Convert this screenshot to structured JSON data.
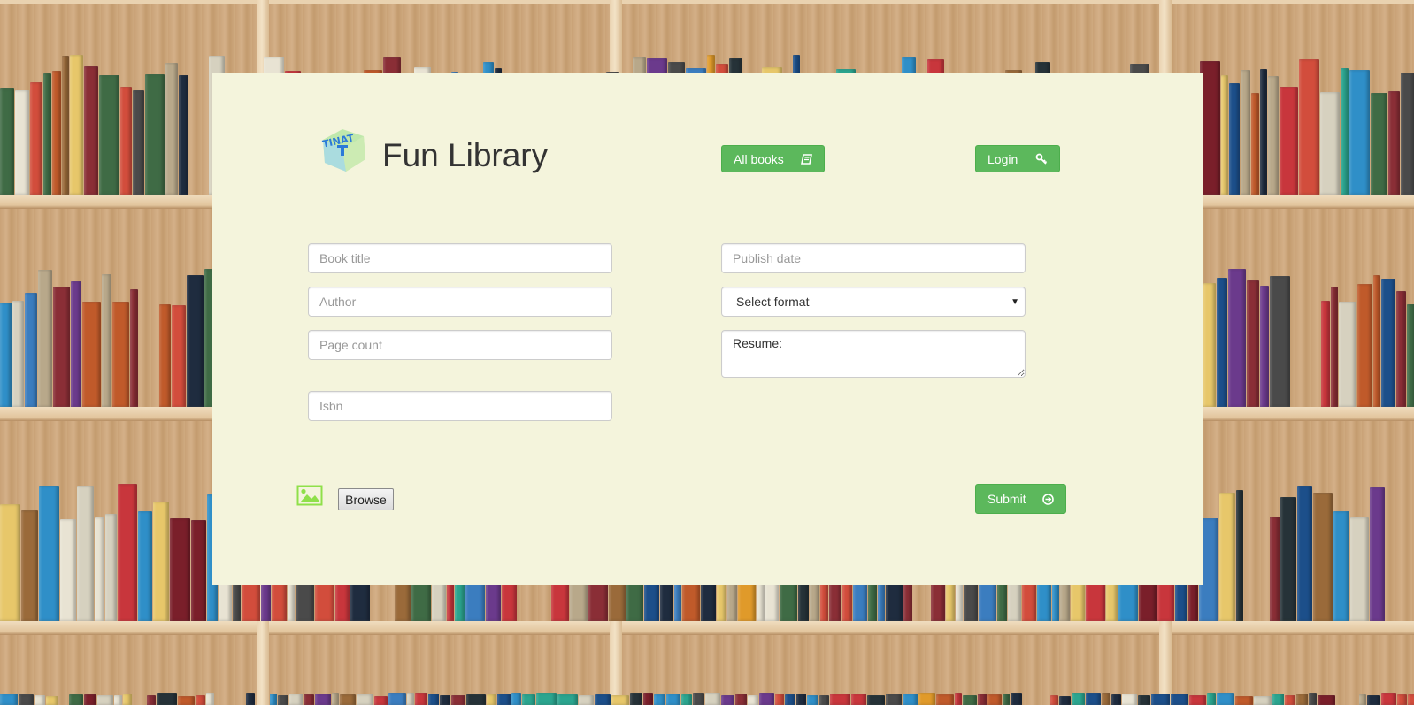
{
  "header": {
    "title": "Fun Library",
    "logo_text": "TINAT",
    "all_books_label": "All books",
    "login_label": "Login"
  },
  "form": {
    "book_title_placeholder": "Book title",
    "author_placeholder": "Author",
    "page_count_placeholder": "Page count",
    "isbn_placeholder": "Isbn",
    "publish_date_placeholder": "Publish date",
    "format_selected": "Select format",
    "resume_value": "Resume:",
    "browse_label": "Browse",
    "submit_label": "Submit"
  },
  "icons": {
    "all_books": "book-icon",
    "login": "key-icon",
    "submit": "arrow-circle-right-icon",
    "upload": "picture-icon",
    "select_caret": "caret-down-icon"
  },
  "colors": {
    "accent": "#5cb85c",
    "panel_bg": "#f4f4dc",
    "image_icon": "#8fe04a"
  }
}
